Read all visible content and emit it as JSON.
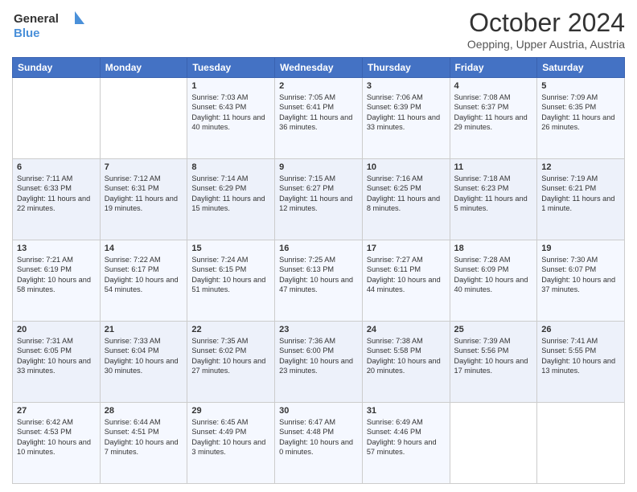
{
  "header": {
    "logo_line1": "General",
    "logo_line2": "Blue",
    "month_title": "October 2024",
    "location": "Oepping, Upper Austria, Austria"
  },
  "days_of_week": [
    "Sunday",
    "Monday",
    "Tuesday",
    "Wednesday",
    "Thursday",
    "Friday",
    "Saturday"
  ],
  "weeks": [
    [
      {
        "day": "",
        "text": ""
      },
      {
        "day": "",
        "text": ""
      },
      {
        "day": "1",
        "text": "Sunrise: 7:03 AM\nSunset: 6:43 PM\nDaylight: 11 hours and 40 minutes."
      },
      {
        "day": "2",
        "text": "Sunrise: 7:05 AM\nSunset: 6:41 PM\nDaylight: 11 hours and 36 minutes."
      },
      {
        "day": "3",
        "text": "Sunrise: 7:06 AM\nSunset: 6:39 PM\nDaylight: 11 hours and 33 minutes."
      },
      {
        "day": "4",
        "text": "Sunrise: 7:08 AM\nSunset: 6:37 PM\nDaylight: 11 hours and 29 minutes."
      },
      {
        "day": "5",
        "text": "Sunrise: 7:09 AM\nSunset: 6:35 PM\nDaylight: 11 hours and 26 minutes."
      }
    ],
    [
      {
        "day": "6",
        "text": "Sunrise: 7:11 AM\nSunset: 6:33 PM\nDaylight: 11 hours and 22 minutes."
      },
      {
        "day": "7",
        "text": "Sunrise: 7:12 AM\nSunset: 6:31 PM\nDaylight: 11 hours and 19 minutes."
      },
      {
        "day": "8",
        "text": "Sunrise: 7:14 AM\nSunset: 6:29 PM\nDaylight: 11 hours and 15 minutes."
      },
      {
        "day": "9",
        "text": "Sunrise: 7:15 AM\nSunset: 6:27 PM\nDaylight: 11 hours and 12 minutes."
      },
      {
        "day": "10",
        "text": "Sunrise: 7:16 AM\nSunset: 6:25 PM\nDaylight: 11 hours and 8 minutes."
      },
      {
        "day": "11",
        "text": "Sunrise: 7:18 AM\nSunset: 6:23 PM\nDaylight: 11 hours and 5 minutes."
      },
      {
        "day": "12",
        "text": "Sunrise: 7:19 AM\nSunset: 6:21 PM\nDaylight: 11 hours and 1 minute."
      }
    ],
    [
      {
        "day": "13",
        "text": "Sunrise: 7:21 AM\nSunset: 6:19 PM\nDaylight: 10 hours and 58 minutes."
      },
      {
        "day": "14",
        "text": "Sunrise: 7:22 AM\nSunset: 6:17 PM\nDaylight: 10 hours and 54 minutes."
      },
      {
        "day": "15",
        "text": "Sunrise: 7:24 AM\nSunset: 6:15 PM\nDaylight: 10 hours and 51 minutes."
      },
      {
        "day": "16",
        "text": "Sunrise: 7:25 AM\nSunset: 6:13 PM\nDaylight: 10 hours and 47 minutes."
      },
      {
        "day": "17",
        "text": "Sunrise: 7:27 AM\nSunset: 6:11 PM\nDaylight: 10 hours and 44 minutes."
      },
      {
        "day": "18",
        "text": "Sunrise: 7:28 AM\nSunset: 6:09 PM\nDaylight: 10 hours and 40 minutes."
      },
      {
        "day": "19",
        "text": "Sunrise: 7:30 AM\nSunset: 6:07 PM\nDaylight: 10 hours and 37 minutes."
      }
    ],
    [
      {
        "day": "20",
        "text": "Sunrise: 7:31 AM\nSunset: 6:05 PM\nDaylight: 10 hours and 33 minutes."
      },
      {
        "day": "21",
        "text": "Sunrise: 7:33 AM\nSunset: 6:04 PM\nDaylight: 10 hours and 30 minutes."
      },
      {
        "day": "22",
        "text": "Sunrise: 7:35 AM\nSunset: 6:02 PM\nDaylight: 10 hours and 27 minutes."
      },
      {
        "day": "23",
        "text": "Sunrise: 7:36 AM\nSunset: 6:00 PM\nDaylight: 10 hours and 23 minutes."
      },
      {
        "day": "24",
        "text": "Sunrise: 7:38 AM\nSunset: 5:58 PM\nDaylight: 10 hours and 20 minutes."
      },
      {
        "day": "25",
        "text": "Sunrise: 7:39 AM\nSunset: 5:56 PM\nDaylight: 10 hours and 17 minutes."
      },
      {
        "day": "26",
        "text": "Sunrise: 7:41 AM\nSunset: 5:55 PM\nDaylight: 10 hours and 13 minutes."
      }
    ],
    [
      {
        "day": "27",
        "text": "Sunrise: 6:42 AM\nSunset: 4:53 PM\nDaylight: 10 hours and 10 minutes."
      },
      {
        "day": "28",
        "text": "Sunrise: 6:44 AM\nSunset: 4:51 PM\nDaylight: 10 hours and 7 minutes."
      },
      {
        "day": "29",
        "text": "Sunrise: 6:45 AM\nSunset: 4:49 PM\nDaylight: 10 hours and 3 minutes."
      },
      {
        "day": "30",
        "text": "Sunrise: 6:47 AM\nSunset: 4:48 PM\nDaylight: 10 hours and 0 minutes."
      },
      {
        "day": "31",
        "text": "Sunrise: 6:49 AM\nSunset: 4:46 PM\nDaylight: 9 hours and 57 minutes."
      },
      {
        "day": "",
        "text": ""
      },
      {
        "day": "",
        "text": ""
      }
    ]
  ]
}
